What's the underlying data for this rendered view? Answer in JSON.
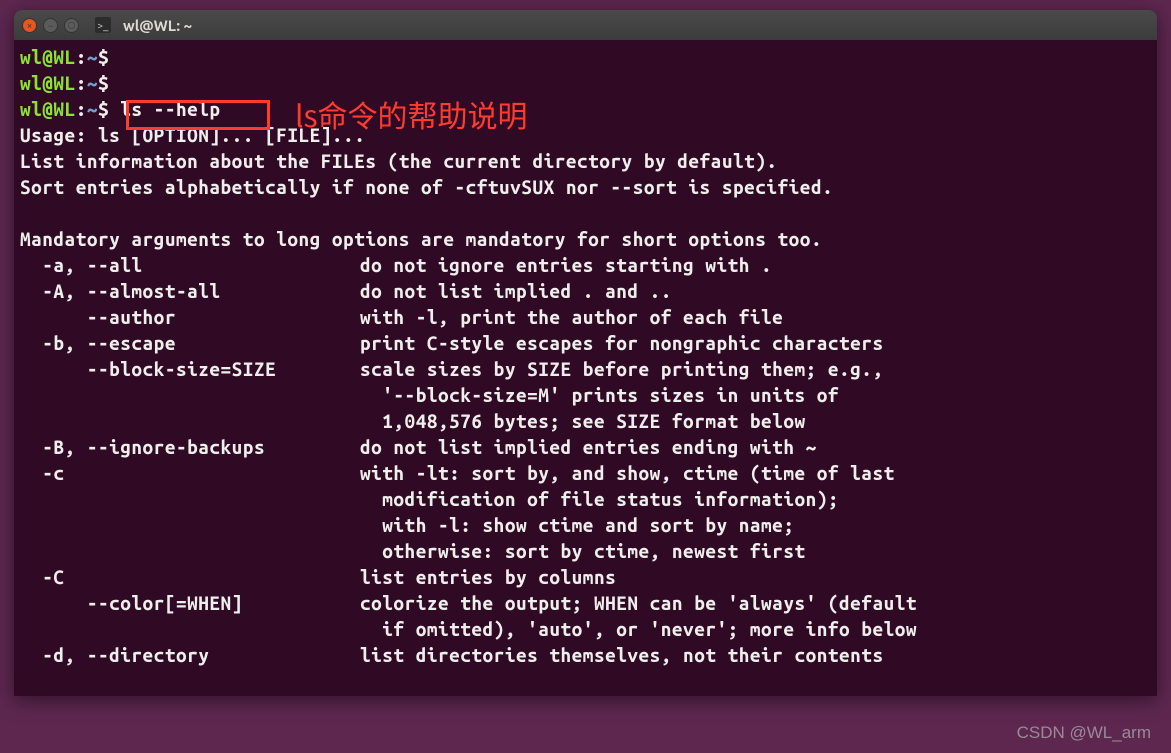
{
  "window": {
    "title": "wl@WL: ~"
  },
  "prompt": {
    "user": "wl",
    "at": "@",
    "host": "WL",
    "colon": ":",
    "path": "~",
    "sym": "$"
  },
  "cmd": "ls --help",
  "annotation": "ls命令的帮助说明",
  "watermark": "CSDN @WL_arm",
  "help": {
    "usage": "Usage: ls [OPTION]... [FILE]...",
    "desc1": "List information about the FILEs (the current directory by default).",
    "desc2": "Sort entries alphabetically if none of -cftuvSUX nor --sort is specified.",
    "blank": "",
    "mand": "Mandatory arguments to long options are mandatory for short options too.",
    "opts": [
      {
        "f": "  -a, --all",
        "d": "do not ignore entries starting with ."
      },
      {
        "f": "  -A, --almost-all",
        "d": "do not list implied . and .."
      },
      {
        "f": "      --author",
        "d": "with -l, print the author of each file"
      },
      {
        "f": "  -b, --escape",
        "d": "print C-style escapes for nongraphic characters"
      },
      {
        "f": "      --block-size=SIZE",
        "d": "scale sizes by SIZE before printing them; e.g.,"
      },
      {
        "f": "",
        "d": "  '--block-size=M' prints sizes in units of"
      },
      {
        "f": "",
        "d": "  1,048,576 bytes; see SIZE format below"
      },
      {
        "f": "  -B, --ignore-backups",
        "d": "do not list implied entries ending with ~"
      },
      {
        "f": "  -c",
        "d": "with -lt: sort by, and show, ctime (time of last"
      },
      {
        "f": "",
        "d": "  modification of file status information);"
      },
      {
        "f": "",
        "d": "  with -l: show ctime and sort by name;"
      },
      {
        "f": "",
        "d": "  otherwise: sort by ctime, newest first"
      },
      {
        "f": "  -C",
        "d": "list entries by columns"
      },
      {
        "f": "      --color[=WHEN]",
        "d": "colorize the output; WHEN can be 'always' (default"
      },
      {
        "f": "",
        "d": "  if omitted), 'auto', or 'never'; more info below"
      },
      {
        "f": "  -d, --directory",
        "d": "list directories themselves, not their contents"
      }
    ]
  }
}
